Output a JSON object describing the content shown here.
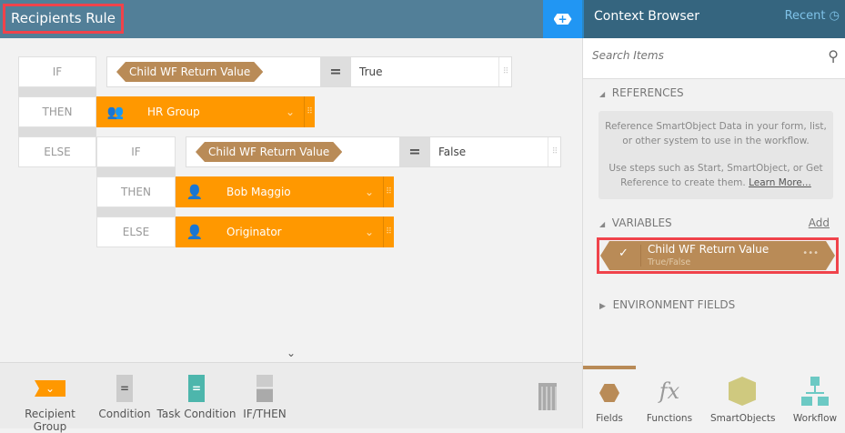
{
  "header": {
    "title": "Recipients Rule",
    "add_icon": "plus-hex-icon"
  },
  "rule": {
    "if1": {
      "keyword": "IF",
      "field": "Child WF Return Value",
      "operator": "=",
      "value": "True"
    },
    "then1": {
      "keyword": "THEN",
      "recipient": "HR Group"
    },
    "else1": {
      "keyword": "ELSE",
      "if_keyword": "IF",
      "field": "Child WF Return Value",
      "operator": "=",
      "value": "False"
    },
    "then2": {
      "keyword": "THEN",
      "recipient": "Bob Maggio"
    },
    "else2": {
      "keyword": "ELSE",
      "recipient": "Originator"
    }
  },
  "toolbar": {
    "items": [
      {
        "label": "Recipient Group"
      },
      {
        "label": "Condition"
      },
      {
        "label": "Task Condition"
      },
      {
        "label": "IF/THEN"
      }
    ],
    "collapse": "⌄"
  },
  "context": {
    "title": "Context Browser",
    "recent": "Recent",
    "search_placeholder": "Search Items",
    "references": {
      "label": "REFERENCES",
      "text1": "Reference SmartObject Data in your form, list, or other system to use in the workflow.",
      "text2": "Use steps such as Start, SmartObject, or Get Reference to create them.",
      "link": "Learn More..."
    },
    "variables": {
      "label": "VARIABLES",
      "add": "Add",
      "item": {
        "name": "Child WF Return Value",
        "type": "True/False",
        "more": "•••"
      }
    },
    "environment": {
      "label": "ENVIRONMENT FIELDS"
    },
    "tabs": [
      {
        "label": "Fields"
      },
      {
        "label": "Functions"
      },
      {
        "label": "SmartObjects"
      },
      {
        "label": "Workflow"
      }
    ]
  },
  "colors": {
    "header": "#527f98",
    "accent": "#2196f3",
    "orange": "#ff9800",
    "field": "#b98b57",
    "highlight": "#f0434b"
  }
}
